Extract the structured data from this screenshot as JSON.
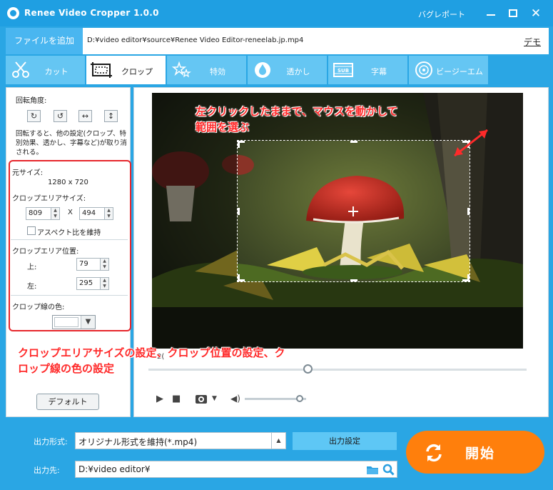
{
  "app": {
    "title": "Renee Video Cropper 1.0.0",
    "bug_report": "バグレポート"
  },
  "file": {
    "add_label": "ファイルを追加",
    "path": "D:¥video editor¥source¥Renee Video Editor-reneelab.jp.mp4",
    "demo_label": "デモ"
  },
  "tabs": [
    {
      "label": "カット",
      "icon": "scissors-icon"
    },
    {
      "label": "クロップ",
      "icon": "crop-icon"
    },
    {
      "label": "特効",
      "icon": "stars-icon"
    },
    {
      "label": "透かし",
      "icon": "droplet-icon"
    },
    {
      "label": "字幕",
      "icon": "subtitle-icon"
    },
    {
      "label": "ビージーエム",
      "icon": "music-icon"
    }
  ],
  "left": {
    "rotation_label": "回転角度:",
    "rotation_note": "回転すると、他の設定(クロップ、特別効果、透かし、字幕など)が取り消される。",
    "original_size_label": "元サイズ:",
    "original_size": "1280 x 720",
    "crop_size_label": "クロップエリアサイズ:",
    "crop_width": "809",
    "crop_height": "494",
    "size_separator": "X",
    "aspect_label": "アスペクト比を維持",
    "position_label": "クロップエリア位置:",
    "top_label": "上:",
    "top_value": "79",
    "left_label": "左:",
    "left_value": "295",
    "line_color_label": "クロップ線の色:",
    "default_label": "デフォルト"
  },
  "preview": {
    "annotation_top_line1": "左クリックしたままで、マウスを動かして",
    "annotation_top_line2": "範囲を選ぶ",
    "annotation_bottom": "クロップエリアサイズの設定、クロップ位置の設定、クロップ線の色の設定",
    "time_fragment": "2(",
    "progress": 0.42,
    "volume": 0.9
  },
  "bottom": {
    "format_label": "出力形式:",
    "format_value": "オリジナル形式を維持(*.mp4)",
    "settings_label": "出力設定",
    "dest_label": "出力先:",
    "dest_value": "D:¥video editor¥",
    "start_label": "開始"
  },
  "colors": {
    "accent": "#1f9fe2",
    "tab_inactive": "#65c6f3",
    "start": "#ff7f0c",
    "annotation": "#ff2a2a"
  }
}
